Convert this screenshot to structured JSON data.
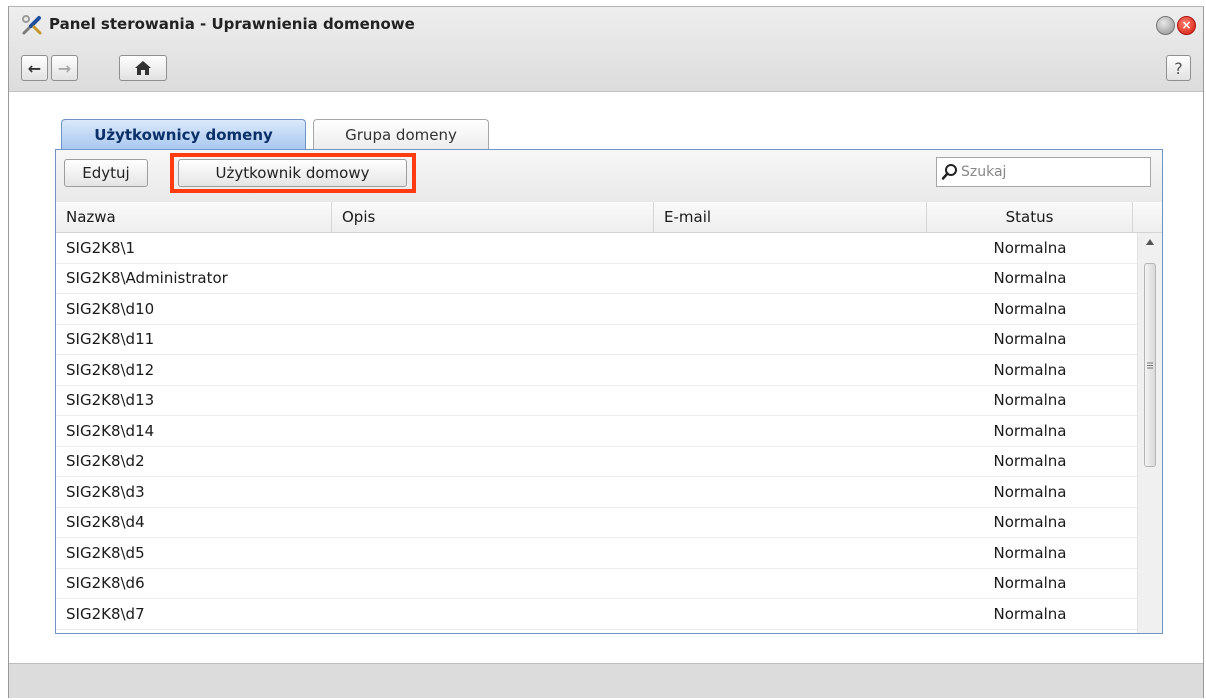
{
  "window": {
    "title": "Panel sterowania - Uprawnienia domenowe",
    "close_label": "×",
    "nav": {
      "back": "←",
      "forward": "→",
      "home": "⌂",
      "help": "?"
    }
  },
  "tabs": [
    {
      "label": "Użytkownicy domeny",
      "active": true
    },
    {
      "label": "Grupa domeny",
      "active": false
    }
  ],
  "toolbar": {
    "edit_label": "Edytuj",
    "home_user_label": "Użytkownik domowy",
    "search_placeholder": "Szukaj"
  },
  "table": {
    "columns": [
      "Nazwa",
      "Opis",
      "E-mail",
      "Status"
    ],
    "rows": [
      {
        "name": "SIG2K8\\1",
        "desc": "",
        "email": "",
        "status": "Normalna"
      },
      {
        "name": "SIG2K8\\Administrator",
        "desc": "",
        "email": "",
        "status": "Normalna"
      },
      {
        "name": "SIG2K8\\d10",
        "desc": "",
        "email": "",
        "status": "Normalna"
      },
      {
        "name": "SIG2K8\\d11",
        "desc": "",
        "email": "",
        "status": "Normalna"
      },
      {
        "name": "SIG2K8\\d12",
        "desc": "",
        "email": "",
        "status": "Normalna"
      },
      {
        "name": "SIG2K8\\d13",
        "desc": "",
        "email": "",
        "status": "Normalna"
      },
      {
        "name": "SIG2K8\\d14",
        "desc": "",
        "email": "",
        "status": "Normalna"
      },
      {
        "name": "SIG2K8\\d2",
        "desc": "",
        "email": "",
        "status": "Normalna"
      },
      {
        "name": "SIG2K8\\d3",
        "desc": "",
        "email": "",
        "status": "Normalna"
      },
      {
        "name": "SIG2K8\\d4",
        "desc": "",
        "email": "",
        "status": "Normalna"
      },
      {
        "name": "SIG2K8\\d5",
        "desc": "",
        "email": "",
        "status": "Normalna"
      },
      {
        "name": "SIG2K8\\d6",
        "desc": "",
        "email": "",
        "status": "Normalna"
      },
      {
        "name": "SIG2K8\\d7",
        "desc": "",
        "email": "",
        "status": "Normalna"
      }
    ]
  },
  "colors": {
    "highlight": "#ff3b0f",
    "active_tab_text": "#0b2f67",
    "panel_border": "#6f95c6"
  },
  "icons": {
    "app": "tools-icon",
    "search": "search-icon",
    "minimize": "minimize-icon",
    "close": "close-icon"
  }
}
